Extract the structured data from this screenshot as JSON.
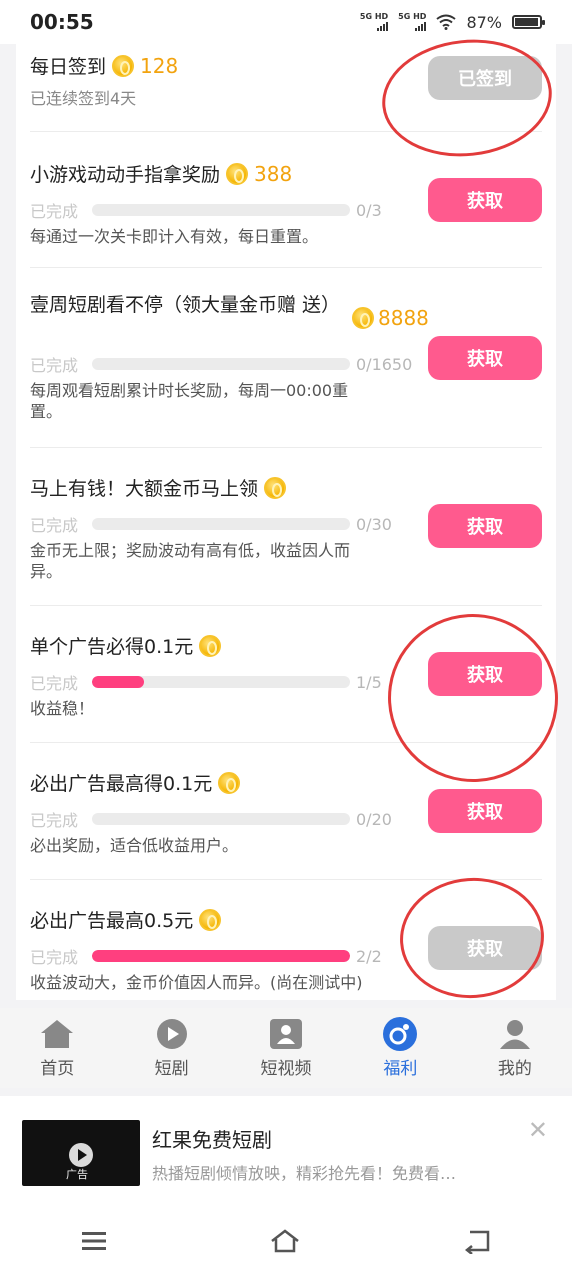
{
  "status": {
    "time": "00:55",
    "battery": "87%",
    "net1": "5G HD",
    "net2": "5G HD"
  },
  "tasks": [
    {
      "title": "每日签到",
      "amount": "128",
      "desc": "已连续签到4天",
      "button": "已签到",
      "done_label": "",
      "count": "",
      "progress": 0
    },
    {
      "title": "小游戏动动手指拿奖励",
      "amount": "388",
      "done_label": "已完成",
      "count": "0/3",
      "progress": 0,
      "desc": "每通过一次关卡即计入有效，每日重置。",
      "button": "获取"
    },
    {
      "title": "壹周短剧看不停（领大量金币赠",
      "title2": "送）",
      "amount": "8888",
      "done_label": "已完成",
      "count": "0/1650",
      "progress": 0,
      "desc": "每周观看短剧累计时长奖励，每周一00:00重",
      "desc2": "置。",
      "button": "获取"
    },
    {
      "title": "马上有钱！大额金币马上领",
      "amount": "",
      "done_label": "已完成",
      "count": "0/30",
      "progress": 0,
      "desc": "金币无上限；奖励波动有高有低，收益因人而",
      "desc2": "异。",
      "button": "获取"
    },
    {
      "title": "单个广告必得0.1元",
      "amount": "",
      "done_label": "已完成",
      "count": "1/5",
      "progress": 0.2,
      "desc": "收益稳！",
      "button": "获取"
    },
    {
      "title": "必出广告最高得0.1元",
      "amount": "",
      "done_label": "已完成",
      "count": "0/20",
      "progress": 0,
      "desc": "必出奖励，适合低收益用户。",
      "button": "获取"
    },
    {
      "title": "必出广告最高0.5元",
      "amount": "",
      "done_label": "已完成",
      "count": "2/2",
      "progress": 1,
      "desc": "收益波动大，金币价值因人而异。(尚在测试中)",
      "button": "获取"
    }
  ],
  "tabs": [
    {
      "label": "首页",
      "icon": "home-icon"
    },
    {
      "label": "短剧",
      "icon": "play-icon"
    },
    {
      "label": "短视频",
      "icon": "video-user-icon"
    },
    {
      "label": "福利",
      "icon": "welfare-icon"
    },
    {
      "label": "我的",
      "icon": "profile-icon"
    }
  ],
  "ad": {
    "title": "红果免费短剧",
    "desc": "热播短剧倾情放映，精彩抢先看！免费看…",
    "tag": "广告"
  },
  "colors": {
    "accent": "#ff5a8e",
    "coin": "#f2a30f",
    "tab_active": "#2a6fdc",
    "annotation": "#e23b3b"
  }
}
